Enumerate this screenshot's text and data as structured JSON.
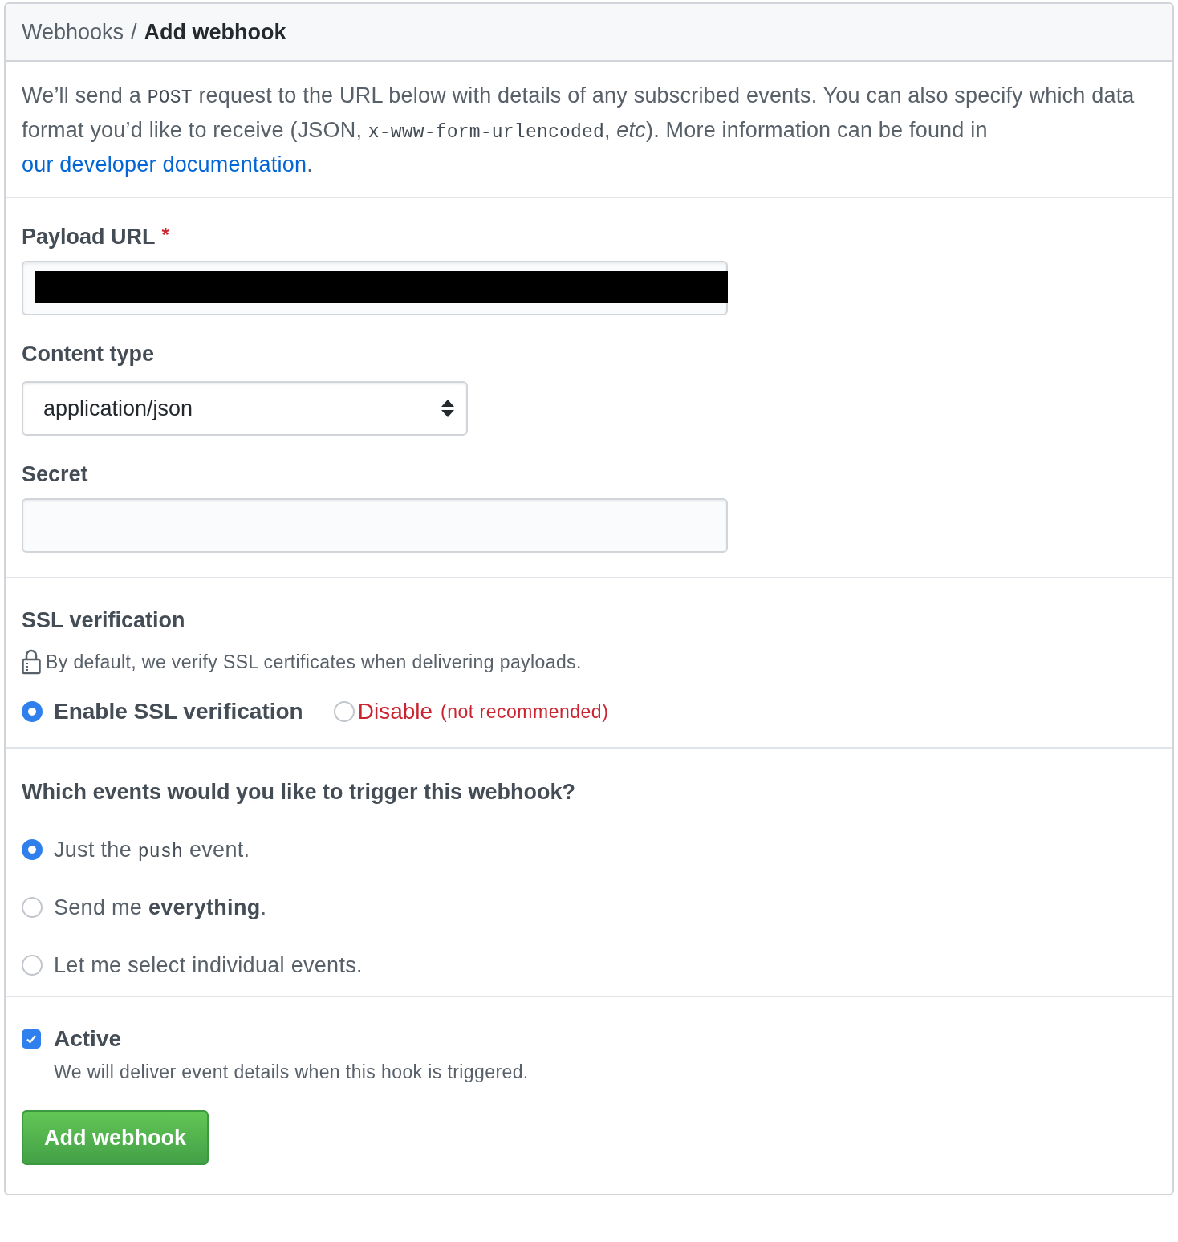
{
  "breadcrumb": {
    "parent": "Webhooks",
    "separator": "/",
    "current": "Add webhook"
  },
  "intro": [
    {
      "kind": "text",
      "text": "We’ll send a "
    },
    {
      "kind": "code",
      "text": "POST"
    },
    {
      "kind": "text",
      "text": " request to the URL below with details of any subscribed events. You can also specify which data format you’d like to receive (JSON, "
    },
    {
      "kind": "code",
      "text": "x-www-form-urlencoded"
    },
    {
      "kind": "text",
      "text": ", *etc*). More information can be found in "
    },
    {
      "kind": "link",
      "text": "our developer documentation"
    },
    {
      "kind": "text",
      "text": "."
    }
  ],
  "payload_url": {
    "label": "Payload URL",
    "required_mark": "*",
    "redacted": true
  },
  "content_type": {
    "label": "Content type",
    "value": "application/json"
  },
  "secret": {
    "label": "Secret"
  },
  "ssl": {
    "title": "SSL verification",
    "note": "By default, we verify SSL certificates when delivering payloads.",
    "options": [
      {
        "kind": "normal",
        "label": "Enable SSL verification",
        "selected": true
      },
      {
        "kind": "danger",
        "label": "Disable",
        "hint": "(not recommended)",
        "selected": false
      }
    ]
  },
  "events": {
    "title": "Which events would you like to trigger this webhook?",
    "options": [
      {
        "selected": true,
        "parts": [
          {
            "kind": "text",
            "text": "Just the "
          },
          {
            "kind": "code",
            "text": "push"
          },
          {
            "kind": "text",
            "text": " event."
          }
        ]
      },
      {
        "selected": false,
        "parts": [
          {
            "kind": "text",
            "text": "Send me **everything**."
          }
        ]
      },
      {
        "selected": false,
        "parts": [
          {
            "kind": "text",
            "text": "Let me select individual events."
          }
        ]
      }
    ]
  },
  "active": {
    "label": "Active",
    "checked": true,
    "description": "We will deliver event details when this hook is triggered."
  },
  "submit": "Add webhook"
}
